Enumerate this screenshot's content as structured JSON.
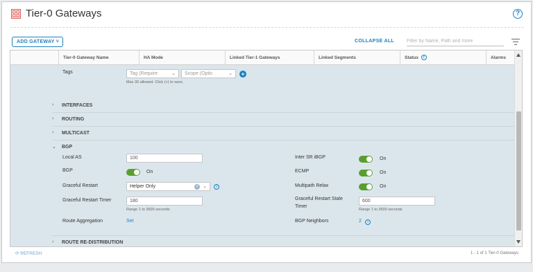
{
  "header": {
    "title": "Tier-0 Gateways",
    "help": "?"
  },
  "toolbar": {
    "add_gateway": "ADD GATEWAY ˅",
    "collapse_all": "COLLAPSE ALL",
    "filter_placeholder": "Filter by Name, Path and more"
  },
  "columns": [
    "Tier-0 Gateway Name",
    "HA Mode",
    "Linked Tier-1 Gateways",
    "Linked Segments",
    "Status",
    "Alarms"
  ],
  "tags": {
    "label": "Tags",
    "tag_placeholder": "Tag (Require",
    "scope_placeholder": "Scope (Optic",
    "hint": "Max 30 allowed. Click (+) to save."
  },
  "sections": {
    "interfaces": "INTERFACES",
    "routing": "ROUTING",
    "multicast": "MULTICAST",
    "bgp": "BGP",
    "route_redistribution": "ROUTE RE-DISTRIBUTION"
  },
  "bgp": {
    "local_as_label": "Local AS",
    "local_as_value": "100",
    "bgp_label": "BGP",
    "bgp_state": "On",
    "graceful_restart_label": "Graceful Restart",
    "graceful_restart_value": "Helper Only",
    "graceful_restart_timer_label": "Graceful Restart Timer",
    "graceful_restart_timer_value": "180",
    "graceful_restart_timer_hint": "Range 1 to 3600 seconds",
    "route_aggregation_label": "Route Aggregation",
    "route_aggregation_link": "Set",
    "inter_sr_label": "Inter SR iBGP",
    "inter_sr_state": "On",
    "ecmp_label": "ECMP",
    "ecmp_state": "On",
    "multipath_label": "Multipath Relax",
    "multipath_state": "On",
    "stale_timer_label_1": "Graceful Restart Stale",
    "stale_timer_label_2": "Timer",
    "stale_timer_value": "600",
    "stale_timer_hint": "Range 1 to 3600 seconds",
    "neighbors_label": "BGP Neighbors",
    "neighbors_count": "2"
  },
  "footer": {
    "refresh": "REFRESH",
    "count": "1 - 1 of 1 Tier-0 Gateways"
  },
  "colors": {
    "accent": "#1a7fbf",
    "toggle_on": "#5a9e2f",
    "expanded_bg": "#dbe6ec"
  }
}
